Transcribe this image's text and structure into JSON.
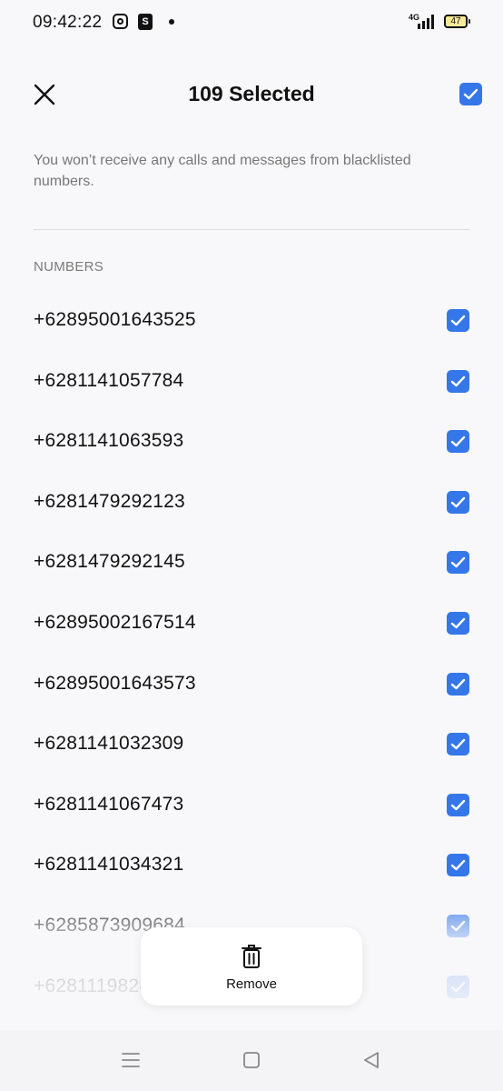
{
  "status_bar": {
    "time": "09:42:22",
    "network": "4G",
    "battery": "47",
    "icons": [
      "instagram-icon",
      "shopee-icon",
      "notification-dot-icon",
      "signal-icon",
      "battery-icon"
    ]
  },
  "header": {
    "title": "109 Selected",
    "close_icon": "close-icon",
    "select_all_checked": true
  },
  "description": "You won’t receive any calls and messages from blacklisted numbers.",
  "section_label": "NUMBERS",
  "numbers": [
    {
      "number": "+62895001643525",
      "checked": true
    },
    {
      "number": "+6281141057784",
      "checked": true
    },
    {
      "number": "+6281141063593",
      "checked": true
    },
    {
      "number": "+6281479292123",
      "checked": true
    },
    {
      "number": "+6281479292145",
      "checked": true
    },
    {
      "number": "+62895002167514",
      "checked": true
    },
    {
      "number": "+62895001643573",
      "checked": true
    },
    {
      "number": "+6281141032309",
      "checked": true
    },
    {
      "number": "+6281141067473",
      "checked": true
    },
    {
      "number": "+6281141034321",
      "checked": true
    },
    {
      "number": "+6285873909684",
      "checked": true
    },
    {
      "number": "+6281119828",
      "checked": true
    }
  ],
  "action": {
    "remove_label": "Remove",
    "icon": "trash-icon"
  },
  "colors": {
    "accent": "#3577e8",
    "background": "#f8f8fa",
    "secondary_text": "#777777"
  },
  "nav_bar": {
    "icons": [
      "menu-icon",
      "home-icon",
      "back-icon"
    ]
  }
}
